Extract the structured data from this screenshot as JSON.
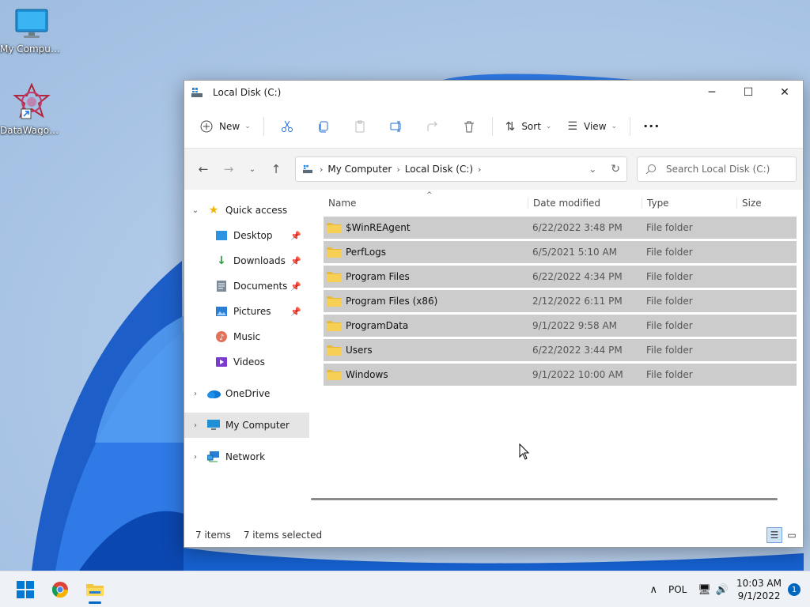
{
  "desktop": {
    "icons": [
      {
        "label": "My Computer",
        "icon": "monitor-icon"
      },
      {
        "label": "DataWagon...",
        "icon": "datawagon-shortcut-icon"
      }
    ]
  },
  "window": {
    "title": "Local Disk (C:)",
    "controls": {
      "minimize": "─",
      "maximize": "☐",
      "close": "✕"
    }
  },
  "toolbar": {
    "new_label": "New",
    "sort_label": "Sort",
    "view_label": "View",
    "more_label": "···"
  },
  "address": {
    "crumbs": [
      "My Computer",
      "Local Disk (C:)"
    ],
    "search_placeholder": "Search Local Disk (C:)"
  },
  "sidebar": {
    "quick_access": "Quick access",
    "items": [
      {
        "label": "Desktop",
        "pinned": true
      },
      {
        "label": "Downloads",
        "pinned": true
      },
      {
        "label": "Documents",
        "pinned": true
      },
      {
        "label": "Pictures",
        "pinned": true
      },
      {
        "label": "Music",
        "pinned": false
      },
      {
        "label": "Videos",
        "pinned": false
      }
    ],
    "onedrive": "OneDrive",
    "my_computer": "My Computer",
    "network": "Network"
  },
  "columns": {
    "name": "Name",
    "date": "Date modified",
    "type": "Type",
    "size": "Size"
  },
  "files": [
    {
      "name": "$WinREAgent",
      "date": "6/22/2022 3:48 PM",
      "type": "File folder"
    },
    {
      "name": "PerfLogs",
      "date": "6/5/2021 5:10 AM",
      "type": "File folder"
    },
    {
      "name": "Program Files",
      "date": "6/22/2022 4:34 PM",
      "type": "File folder"
    },
    {
      "name": "Program Files (x86)",
      "date": "2/12/2022 6:11 PM",
      "type": "File folder"
    },
    {
      "name": "ProgramData",
      "date": "9/1/2022 9:58 AM",
      "type": "File folder"
    },
    {
      "name": "Users",
      "date": "6/22/2022 3:44 PM",
      "type": "File folder"
    },
    {
      "name": "Windows",
      "date": "9/1/2022 10:00 AM",
      "type": "File folder"
    }
  ],
  "status": {
    "items": "7 items",
    "selected": "7 items selected"
  },
  "taskbar": {
    "apps": [
      "start-icon",
      "chrome-icon",
      "file-explorer-icon"
    ],
    "lang": "POL",
    "time": "10:03 AM",
    "date": "9/1/2022",
    "notifications": "1"
  },
  "colors": {
    "accent": "#0067c0",
    "folder": "#f4c542",
    "selection": "#cccccc"
  }
}
